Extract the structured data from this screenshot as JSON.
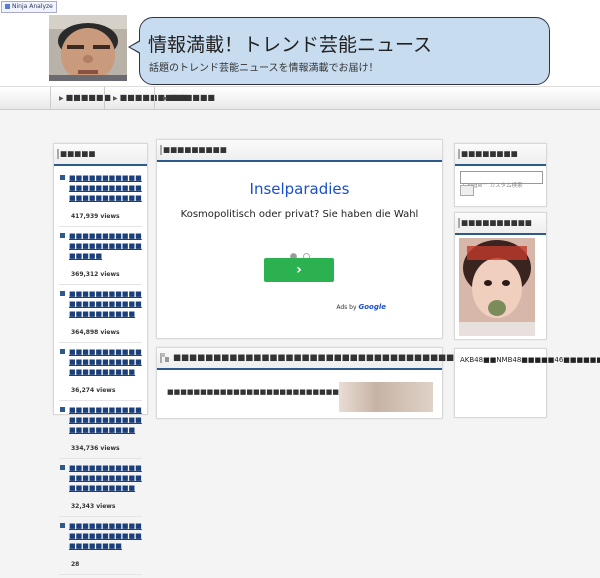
{
  "topbar": {
    "badge_label": "Ninja Analyze"
  },
  "header": {
    "title": "情報満載！トレンド芸能ニュース",
    "description": "話題のトレンド芸能ニュースを情報満載でお届け！"
  },
  "nav": {
    "items": [
      {
        "label": "■■■■■■"
      },
      {
        "label": "■■■■■■■■■"
      },
      {
        "label": "■■■■■■"
      }
    ]
  },
  "left_sidebar": {
    "heading": "■■■■■",
    "items": [
      {
        "title": "■■■■■■■■■■■■■■■■■■■■■■■■■■■■■■■■■",
        "views": "417,939 views"
      },
      {
        "title": "■■■■■■■■■■■■■■■■■■■■■■■■■■■",
        "views": "369,312 views"
      },
      {
        "title": "■■■■■■■■■■■■■■■■■■■■■■■■■■■■■■■■",
        "views": "364,898 views"
      },
      {
        "title": "■■■■■■■■■■■■■■■■■■■■■■■■■■■■■■■■",
        "views": "36,274 views"
      },
      {
        "title": "■■■■■■■■■■■■■■■■■■■■■■■■■■■■■■■■",
        "views": "334,736 views"
      },
      {
        "title": "■■■■■■■■■■■■■■■■■■■■■■■■■■■■■■■■",
        "views": "32,343 views"
      },
      {
        "title": "■■■■■■■■■■■■■■■■■■■■■■■■■■■■■■",
        "views": "28"
      }
    ]
  },
  "ad": {
    "heading": "■■■■■■■■■",
    "title": "Inselparadies",
    "text": "Kosmopolitisch oder privat? Sie haben die Wahl",
    "button_glyph": "›",
    "ads_by": "Ads by",
    "ads_brand": "Google"
  },
  "article": {
    "title": "■■■■■■■■■■■■■■■■■■■■■■■■■■■■■■■■■■■■■■■■",
    "excerpt": "■■■■■■■■■■■■■■■■■■■■■■■■■■■■■■■■■■■■■"
  },
  "right_sidebar": {
    "search_heading": "■■■■■■■■",
    "search_placeholder": "Google™ カスタム検索",
    "image_heading": "■■■■■■■■■■",
    "news_text": "AKB48■■NMB48■■■■■46■■■■■■■■■"
  },
  "colors": {
    "accent": "#2c5a8a",
    "bubble": "#c8dcf0",
    "ad_button": "#2bb14f",
    "ad_title": "#1a4fd0"
  }
}
